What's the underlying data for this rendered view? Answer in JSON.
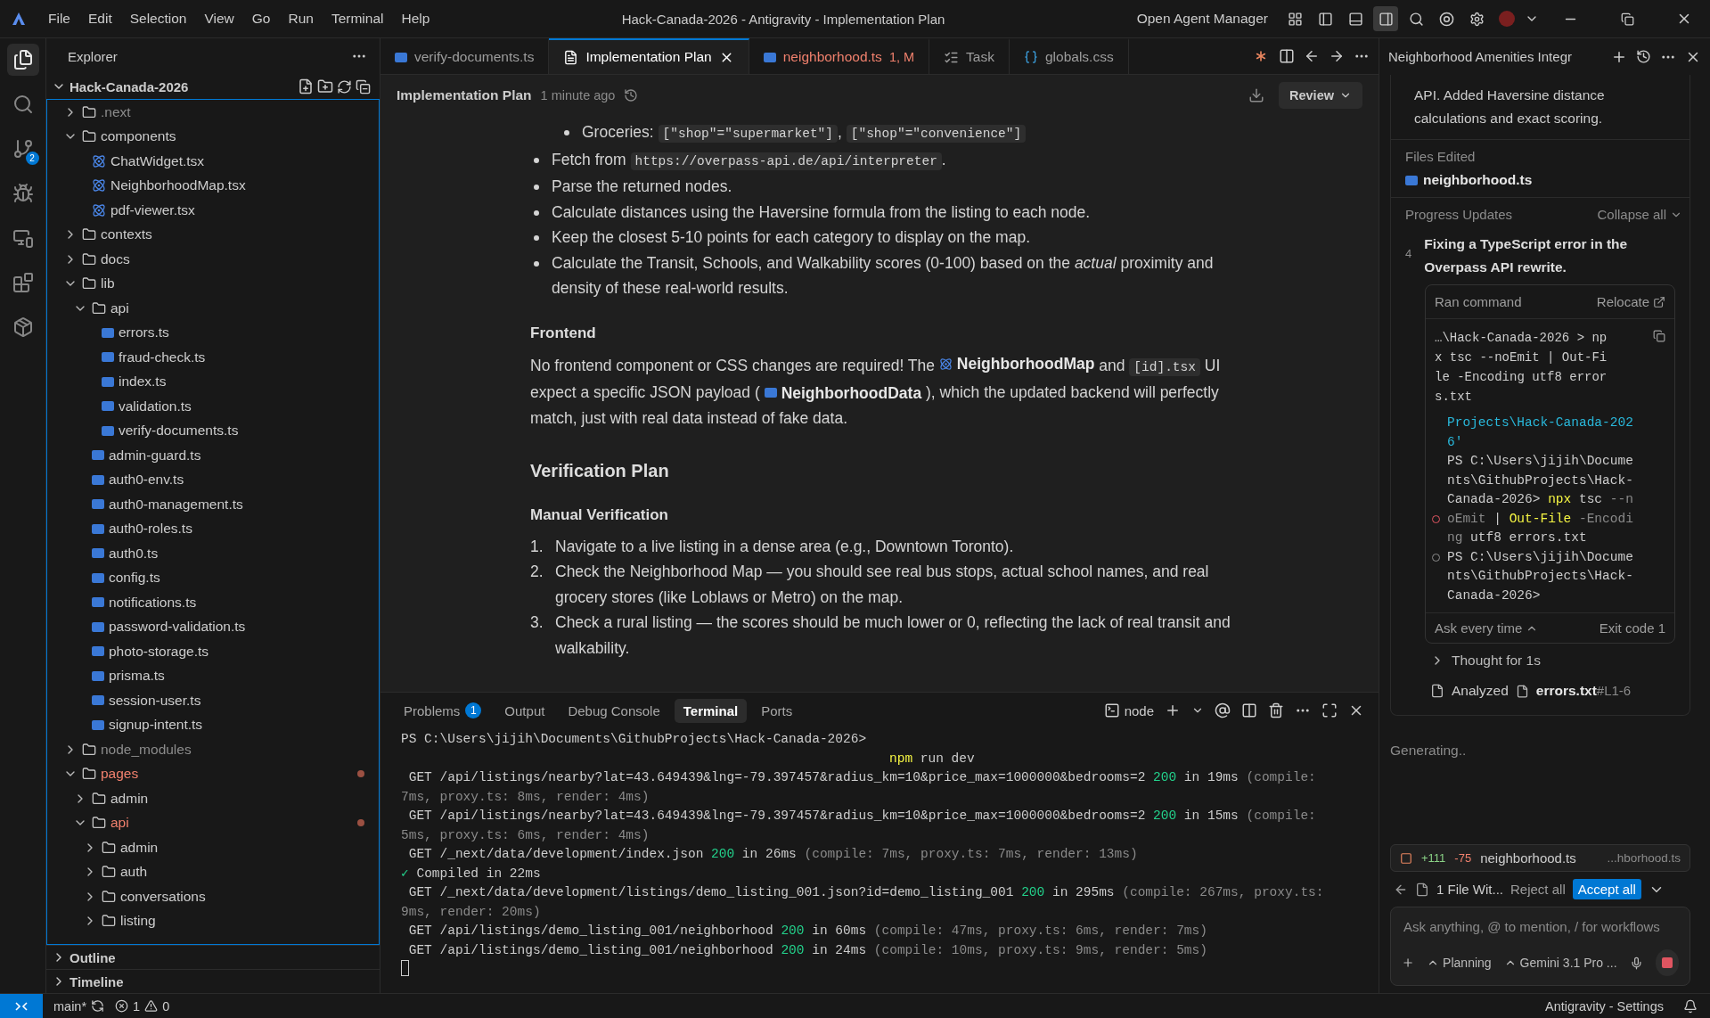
{
  "title_bar": {
    "menu": [
      "File",
      "Edit",
      "Selection",
      "View",
      "Go",
      "Run",
      "Terminal",
      "Help"
    ],
    "title": "Hack-Canada-2026 - Antigravity - Implementation Plan",
    "agent_manager": "Open Agent Manager"
  },
  "activity_bar": {
    "source_control_badge": "2"
  },
  "explorer": {
    "title": "Explorer",
    "root": "Hack-Canada-2026",
    "tree": [
      {
        "label": ".next",
        "kind": "folder",
        "expanded": false,
        "ignored": true
      },
      {
        "label": "components",
        "kind": "folder",
        "expanded": true,
        "children": [
          {
            "label": "ChatWidget.tsx",
            "kind": "react"
          },
          {
            "label": "NeighborhoodMap.tsx",
            "kind": "react"
          },
          {
            "label": "pdf-viewer.tsx",
            "kind": "react"
          }
        ]
      },
      {
        "label": "contexts",
        "kind": "folder",
        "expanded": false
      },
      {
        "label": "docs",
        "kind": "folder",
        "expanded": false
      },
      {
        "label": "lib",
        "kind": "folder",
        "expanded": true,
        "children": [
          {
            "label": "api",
            "kind": "folder",
            "expanded": true,
            "children": [
              {
                "label": "errors.ts",
                "kind": "ts"
              },
              {
                "label": "fraud-check.ts",
                "kind": "ts"
              },
              {
                "label": "index.ts",
                "kind": "ts"
              },
              {
                "label": "validation.ts",
                "kind": "ts"
              },
              {
                "label": "verify-documents.ts",
                "kind": "ts"
              }
            ]
          },
          {
            "label": "admin-guard.ts",
            "kind": "ts"
          },
          {
            "label": "auth0-env.ts",
            "kind": "ts"
          },
          {
            "label": "auth0-management.ts",
            "kind": "ts"
          },
          {
            "label": "auth0-roles.ts",
            "kind": "ts"
          },
          {
            "label": "auth0.ts",
            "kind": "ts"
          },
          {
            "label": "config.ts",
            "kind": "ts"
          },
          {
            "label": "notifications.ts",
            "kind": "ts"
          },
          {
            "label": "password-validation.ts",
            "kind": "ts"
          },
          {
            "label": "photo-storage.ts",
            "kind": "ts"
          },
          {
            "label": "prisma.ts",
            "kind": "ts"
          },
          {
            "label": "session-user.ts",
            "kind": "ts"
          },
          {
            "label": "signup-intent.ts",
            "kind": "ts"
          }
        ]
      },
      {
        "label": "node_modules",
        "kind": "folder",
        "expanded": false,
        "ignored": true
      },
      {
        "label": "pages",
        "kind": "folder",
        "expanded": true,
        "modified": true,
        "children": [
          {
            "label": "admin",
            "kind": "folder",
            "expanded": false
          },
          {
            "label": "api",
            "kind": "folder",
            "expanded": true,
            "modified": true,
            "children": [
              {
                "label": "admin",
                "kind": "folder",
                "expanded": false
              },
              {
                "label": "auth",
                "kind": "folder",
                "expanded": false
              },
              {
                "label": "conversations",
                "kind": "folder",
                "expanded": false
              },
              {
                "label": "listing",
                "kind": "folder",
                "expanded": false
              }
            ]
          }
        ]
      }
    ],
    "sections": [
      "Outline",
      "Timeline"
    ]
  },
  "editor": {
    "tabs": [
      {
        "label": "verify-documents.ts",
        "kind": "ts",
        "selected": false
      },
      {
        "label": "Implementation Plan",
        "kind": "doc",
        "selected": true
      },
      {
        "label": "neighborhood.ts",
        "kind": "ts",
        "selected": false,
        "error": true,
        "badge": "1, M"
      },
      {
        "label": "Task",
        "kind": "task",
        "selected": false
      },
      {
        "label": "globals.css",
        "kind": "css",
        "selected": false
      }
    ],
    "header": {
      "title": "Implementation Plan",
      "time": "1 minute ago",
      "review": "Review"
    },
    "blocks": [
      {
        "kind": "list",
        "items": [
          {
            "children": [
              {
                "parts": [
                  {
                    "kind": "text",
                    "text": "Groceries: "
                  },
                  {
                    "kind": "code",
                    "text": "[\"shop\"=\"supermarket\"]"
                  },
                  {
                    "kind": "text",
                    "text": ", "
                  },
                  {
                    "kind": "code",
                    "text": "[\"shop\"=\"convenience\"]"
                  }
                ]
              }
            ]
          },
          {
            "parts": [
              {
                "kind": "text",
                "text": "Fetch from "
              },
              {
                "kind": "code",
                "text": "https://overpass-api.de/api/interpreter"
              },
              {
                "kind": "text",
                "text": "."
              }
            ]
          },
          {
            "parts": [
              {
                "kind": "text",
                "text": "Parse the returned nodes."
              }
            ]
          },
          {
            "parts": [
              {
                "kind": "text",
                "text": "Calculate distances using the Haversine formula from the listing to each node."
              }
            ]
          },
          {
            "parts": [
              {
                "kind": "text",
                "text": "Keep the closest 5-10 points for each category to display on the map."
              }
            ]
          },
          {
            "parts": [
              {
                "kind": "text",
                "text": "Calculate the Transit, Schools, and Walkability scores (0-100) based on the *actual* proximity and density of these real-world results."
              }
            ]
          }
        ]
      },
      {
        "kind": "h3",
        "text": "Frontend"
      },
      {
        "kind": "paragraph",
        "parts": [
          {
            "kind": "text",
            "text": "No frontend component or CSS changes are required! The "
          },
          {
            "kind": "react-ref",
            "text": "NeighborhoodMap"
          },
          {
            "kind": "text",
            "text": " and "
          },
          {
            "kind": "code",
            "text": "[id].tsx"
          },
          {
            "kind": "text",
            "text": " UI expect a specific JSON payload ( "
          },
          {
            "kind": "ts-ref",
            "text": "NeighborhoodData"
          },
          {
            "kind": "text",
            "text": " ), which the updated backend will perfectly match, just with real data instead of fake data."
          }
        ]
      },
      {
        "kind": "h2",
        "text": "Verification Plan"
      },
      {
        "kind": "h3",
        "text": "Manual Verification"
      },
      {
        "kind": "ordered",
        "items": [
          {
            "number": "1.",
            "parts": [
              {
                "kind": "text",
                "text": "Navigate to a live listing in a dense area (e.g., Downtown Toronto)."
              }
            ]
          },
          {
            "number": "2.",
            "parts": [
              {
                "kind": "text",
                "text": "Check the Neighborhood Map — you should see real bus stops, actual school names, and real grocery stores (like Loblaws or Metro) on the map."
              }
            ]
          },
          {
            "number": "3.",
            "parts": [
              {
                "kind": "text",
                "text": "Check a rural listing — the scores should be much lower or 0, reflecting the lack of real transit and walkability."
              }
            ]
          }
        ]
      }
    ]
  },
  "panel": {
    "tabs": [
      {
        "label": "Problems",
        "badge": "1",
        "selected": false
      },
      {
        "label": "Output",
        "selected": false
      },
      {
        "label": "Debug Console",
        "selected": false
      },
      {
        "label": "Terminal",
        "selected": true
      },
      {
        "label": "Ports",
        "selected": false
      }
    ],
    "shell": "node",
    "lines": [
      {
        "segments": [
          {
            "kind": "text",
            "text": "PS C:\\Users\\jijih\\Documents\\GithubProjects\\Hack-Canada-2026>"
          }
        ]
      },
      {
        "kind": "wrapped",
        "segments": [
          {
            "kind": "cmd",
            "text": "npm"
          },
          {
            "kind": "text",
            "text": " run dev"
          }
        ]
      },
      {
        "segments": [
          {
            "kind": "text",
            "text": " GET /api/listings/nearby?lat=43.649439&lng=-79.397457&radius_km=10&price_max=1000000&bedrooms=2 "
          },
          {
            "kind": "ok",
            "text": "200"
          },
          {
            "kind": "text",
            "text": " in 19ms "
          },
          {
            "kind": "dim",
            "text": "(compile:"
          }
        ]
      },
      {
        "segments": [
          {
            "kind": "dim",
            "text": "7ms, proxy.ts: 8ms, render: 4ms)"
          }
        ]
      },
      {
        "segments": [
          {
            "kind": "text",
            "text": " GET /api/listings/nearby?lat=43.649439&lng=-79.397457&radius_km=10&price_max=1000000&bedrooms=2 "
          },
          {
            "kind": "ok",
            "text": "200"
          },
          {
            "kind": "text",
            "text": " in 15ms "
          },
          {
            "kind": "dim",
            "text": "(compile:"
          }
        ]
      },
      {
        "segments": [
          {
            "kind": "dim",
            "text": "5ms, proxy.ts: 6ms, render: 4ms)"
          }
        ]
      },
      {
        "segments": [
          {
            "kind": "text",
            "text": " GET /_next/data/development/index.json "
          },
          {
            "kind": "ok",
            "text": "200"
          },
          {
            "kind": "text",
            "text": " in 26ms "
          },
          {
            "kind": "dim",
            "text": "(compile: 7ms, proxy.ts: 7ms, render: 13ms)"
          }
        ]
      },
      {
        "segments": [
          {
            "kind": "ok",
            "text": "✓"
          },
          {
            "kind": "text",
            "text": " Compiled in 22ms"
          }
        ]
      },
      {
        "segments": [
          {
            "kind": "text",
            "text": " GET /_next/data/development/listings/demo_listing_001.json?id=demo_listing_001 "
          },
          {
            "kind": "ok",
            "text": "200"
          },
          {
            "kind": "text",
            "text": " in 295ms "
          },
          {
            "kind": "dim",
            "text": "(compile: 267ms, proxy.ts:"
          }
        ]
      },
      {
        "segments": [
          {
            "kind": "dim",
            "text": "9ms, render: 20ms)"
          }
        ]
      },
      {
        "segments": [
          {
            "kind": "text",
            "text": " GET /api/listings/demo_listing_001/neighborhood "
          },
          {
            "kind": "ok",
            "text": "200"
          },
          {
            "kind": "text",
            "text": " in 60ms "
          },
          {
            "kind": "dim",
            "text": "(compile: 47ms, proxy.ts: 6ms, render: 7ms)"
          }
        ]
      },
      {
        "segments": [
          {
            "kind": "text",
            "text": " GET /api/listings/demo_listing_001/neighborhood "
          },
          {
            "kind": "ok",
            "text": "200"
          },
          {
            "kind": "text",
            "text": " in 24ms "
          },
          {
            "kind": "dim",
            "text": "(compile: 10ms, proxy.ts: 9ms, render: 5ms)"
          }
        ]
      }
    ]
  },
  "agent": {
    "title": "Neighborhood Amenities Integr",
    "summary": "API. Added Haversine distance calculations and exact scoring.",
    "files_heading": "Files Edited",
    "files": [
      "neighborhood.ts"
    ],
    "progress_heading": "Progress Updates",
    "collapse": "Collapse all",
    "step": {
      "number": "4",
      "text": "Fixing a TypeScript error in the Overpass API rewrite."
    },
    "command": {
      "label": "Ran command",
      "relocate": "Relocate",
      "lines": [
        "…\\Hack-Canada-2026 > np",
        "x tsc --noEmit | Out-Fi",
        "le -Encoding utf8 error",
        "s.txt"
      ],
      "output": [
        {
          "segments": [
            {
              "kind": "link",
              "text": "Projects\\Hack-Canada-202"
            }
          ]
        },
        {
          "segments": [
            {
              "kind": "link",
              "text": "6'"
            }
          ]
        },
        {
          "segments": [
            {
              "kind": "text",
              "text": "PS C:\\Users\\jijih\\Docume"
            }
          ]
        },
        {
          "segments": [
            {
              "kind": "text",
              "text": "nts\\GithubProjects\\Hack-"
            }
          ]
        },
        {
          "segments": [
            {
              "kind": "text",
              "text": "Canada-2026> "
            },
            {
              "kind": "cmd",
              "text": "npx"
            },
            {
              "kind": "text",
              "text": " tsc "
            },
            {
              "kind": "dim",
              "text": "--n"
            }
          ]
        },
        {
          "kind": "error",
          "segments": [
            {
              "kind": "dim",
              "text": "oEmit"
            },
            {
              "kind": "text",
              "text": " | "
            },
            {
              "kind": "cmd",
              "text": "Out-File"
            },
            {
              "kind": "dim",
              "text": " -Encodi"
            }
          ]
        },
        {
          "segments": [
            {
              "kind": "dim",
              "text": "ng"
            },
            {
              "kind": "text",
              "text": " utf8 errors.txt"
            }
          ]
        },
        {
          "kind": "done",
          "segments": [
            {
              "kind": "text",
              "text": "PS C:\\Users\\jijih\\Docume"
            }
          ]
        },
        {
          "segments": [
            {
              "kind": "text",
              "text": "nts\\GithubProjects\\Hack-"
            }
          ]
        },
        {
          "segments": [
            {
              "kind": "text",
              "text": "Canada-2026>"
            }
          ]
        }
      ],
      "policy": "Ask every time",
      "exit": "Exit code 1"
    },
    "thought": "Thought for 1s",
    "analyzed": {
      "label": "Analyzed",
      "file": "errors.txt",
      "range": "#L1-6"
    },
    "status": "Generating..",
    "changes": {
      "added": "+111",
      "removed": "-75",
      "file": "neighborhood.ts",
      "path": "...hborhood.ts",
      "summary": "1 File Wit...",
      "reject": "Reject all",
      "accept": "Accept all"
    },
    "input": {
      "placeholder": "Ask anything, @ to mention, / for workflows",
      "mode": "Planning",
      "model": "Gemini 3.1 Pro ..."
    }
  },
  "status_bar": {
    "branch": "main*",
    "errors": "1",
    "warnings": "0",
    "right": "Antigravity - Settings"
  }
}
